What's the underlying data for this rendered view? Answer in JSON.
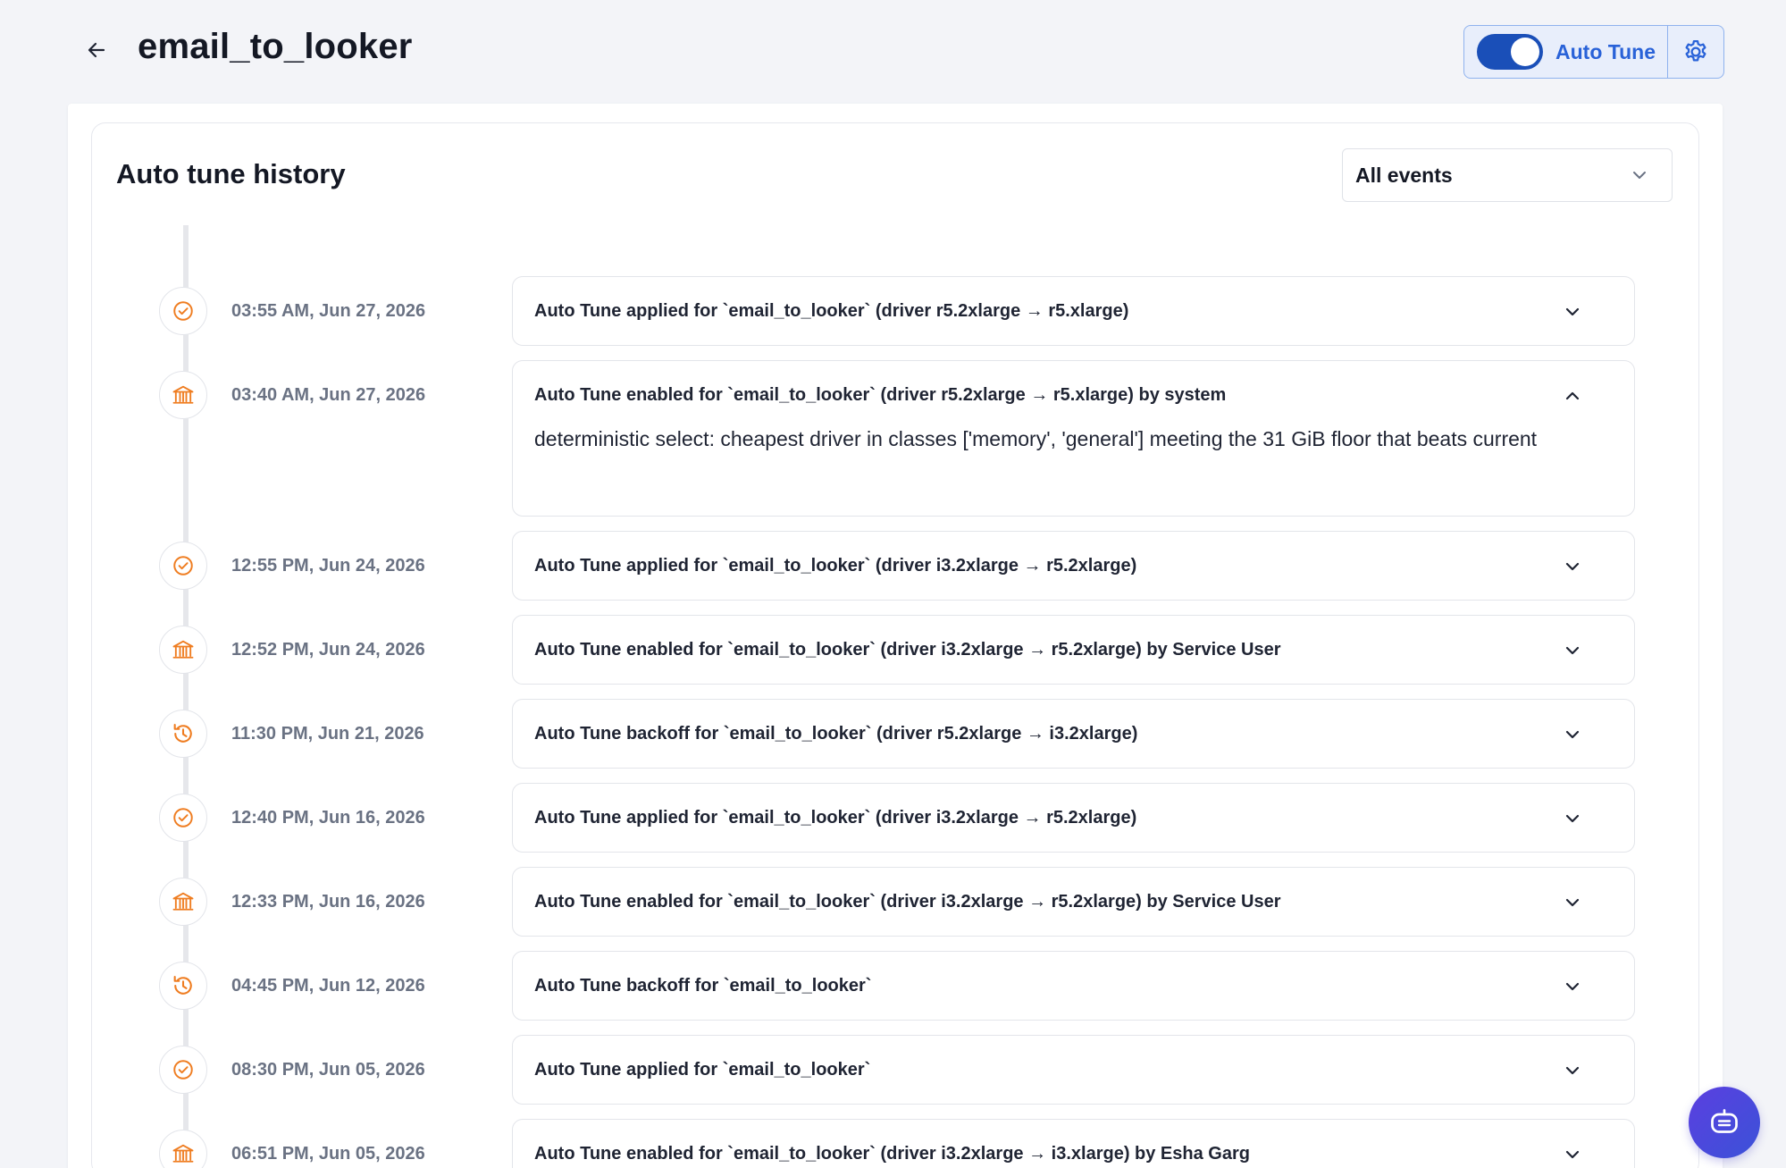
{
  "header": {
    "title": "email_to_looker",
    "auto_tune_label": "Auto Tune",
    "auto_tune_enabled": true
  },
  "history": {
    "title": "Auto tune history",
    "filter_value": "All events"
  },
  "colors": {
    "accent": "#2962d8",
    "toggle": "#1a4fb8",
    "event_icon": "#ef7d21"
  },
  "events": [
    {
      "icon": "check-circle-icon",
      "time": "03:55 AM, Jun 27, 2026",
      "text": "Auto Tune applied for `email_to_looker` (driver r5.2xlarge → r5.xlarge)",
      "expanded": false
    },
    {
      "icon": "bank-icon",
      "time": "03:40 AM, Jun 27, 2026",
      "text": "Auto Tune enabled for `email_to_looker` (driver r5.2xlarge → r5.xlarge) by system",
      "expanded": true,
      "detail": "deterministic select: cheapest driver in classes ['memory', 'general'] meeting the 31 GiB floor that beats current"
    },
    {
      "icon": "check-circle-icon",
      "time": "12:55 PM, Jun 24, 2026",
      "text": "Auto Tune applied for `email_to_looker` (driver i3.2xlarge → r5.2xlarge)",
      "expanded": false
    },
    {
      "icon": "bank-icon",
      "time": "12:52 PM, Jun 24, 2026",
      "text": "Auto Tune enabled for `email_to_looker` (driver i3.2xlarge → r5.2xlarge) by Service User",
      "expanded": false
    },
    {
      "icon": "history-icon",
      "time": "11:30 PM, Jun 21, 2026",
      "text": "Auto Tune backoff for `email_to_looker` (driver r5.2xlarge → i3.2xlarge)",
      "expanded": false
    },
    {
      "icon": "check-circle-icon",
      "time": "12:40 PM, Jun 16, 2026",
      "text": "Auto Tune applied for `email_to_looker` (driver i3.2xlarge → r5.2xlarge)",
      "expanded": false
    },
    {
      "icon": "bank-icon",
      "time": "12:33 PM, Jun 16, 2026",
      "text": "Auto Tune enabled for `email_to_looker` (driver i3.2xlarge → r5.2xlarge) by Service User",
      "expanded": false
    },
    {
      "icon": "history-icon",
      "time": "04:45 PM, Jun 12, 2026",
      "text": "Auto Tune backoff for `email_to_looker`",
      "expanded": false
    },
    {
      "icon": "check-circle-icon",
      "time": "08:30 PM, Jun 05, 2026",
      "text": "Auto Tune applied for `email_to_looker`",
      "expanded": false
    },
    {
      "icon": "bank-icon",
      "time": "06:51 PM, Jun 05, 2026",
      "text": "Auto Tune enabled for `email_to_looker` (driver i3.2xlarge → i3.xlarge) by Esha Garg",
      "expanded": false
    }
  ]
}
